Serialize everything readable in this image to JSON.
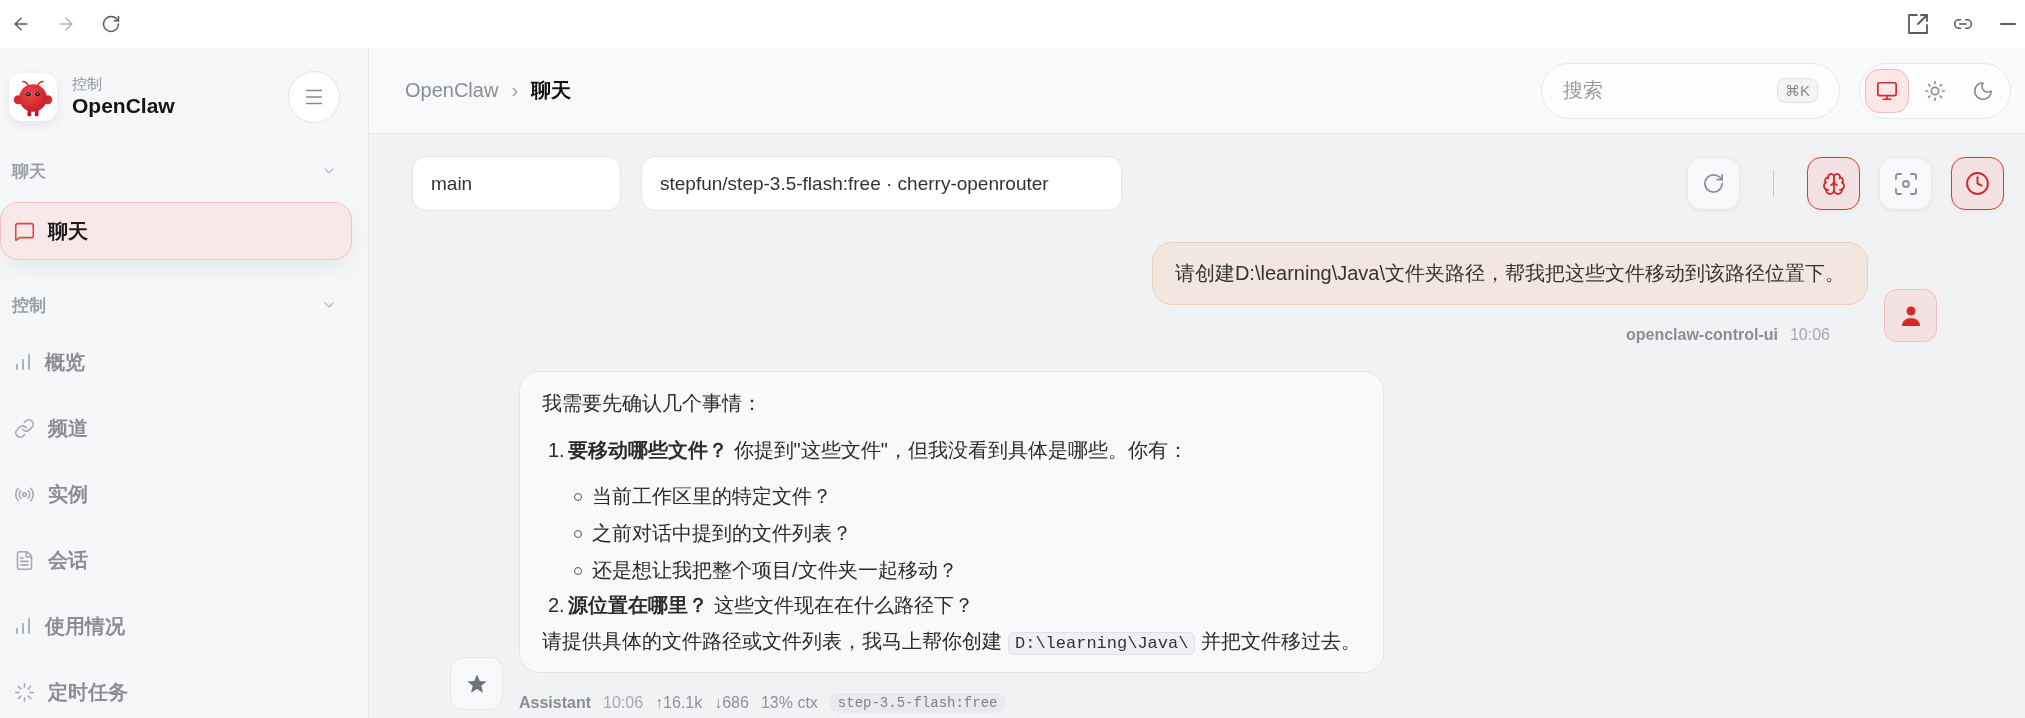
{
  "browser_bar": {
    "back_disabled": false,
    "forward_disabled": true
  },
  "sidebar": {
    "brand": {
      "subtitle": "控制",
      "name": "OpenClaw"
    },
    "sections": [
      {
        "title": "聊天",
        "expanded": true,
        "items": [
          {
            "label": "聊天",
            "kind": "chat",
            "selected": true
          }
        ]
      },
      {
        "title": "控制",
        "expanded": true,
        "items": [
          {
            "label": "概览",
            "kind": "bars",
            "selected": false
          },
          {
            "label": "频道",
            "kind": "link",
            "selected": false
          },
          {
            "label": "实例",
            "kind": "broadcast",
            "selected": false
          },
          {
            "label": "会话",
            "kind": "document",
            "selected": false
          },
          {
            "label": "使用情况",
            "kind": "bars",
            "selected": false
          },
          {
            "label": "定时任务",
            "kind": "loader",
            "selected": false
          }
        ]
      }
    ]
  },
  "header": {
    "breadcrumb": {
      "items": [
        "OpenClaw",
        "聊天"
      ],
      "separator": "›"
    },
    "search": {
      "placeholder": "搜索",
      "shortcut": "⌘K"
    },
    "theme_modes": [
      {
        "kind": "system",
        "selected": true
      },
      {
        "kind": "light",
        "selected": false
      },
      {
        "kind": "dark",
        "selected": false
      }
    ]
  },
  "chat_controls": {
    "session": "main",
    "model": "stepfun/step-3.5-flash:free · cherry-openrouter",
    "actions": [
      {
        "kind": "refresh",
        "on": false
      },
      {
        "kind": "thinking",
        "on": true
      },
      {
        "kind": "focus",
        "on": false
      },
      {
        "kind": "schedule",
        "on": true
      }
    ]
  },
  "messages": [
    {
      "kind": "user",
      "text": "请创建D:\\learning\\Java\\文件夹路径，帮我把这些文件移动到该路径位置下。",
      "sender": "openclaw-control-ui",
      "time": "10:06"
    },
    {
      "kind": "assistant",
      "blocks": [
        {
          "kind": "paragraph",
          "parts": [
            {
              "kind": "text",
              "text": "我需要先确认几个事情："
            }
          ]
        },
        {
          "kind": "ordered_list",
          "items": [
            {
              "number": "1.",
              "text": "**要移动哪些文件？** 你提到\"这些文件\"，但我没看到具体是哪些。你有：",
              "children": [
                "当前工作区里的特定文件？",
                "之前对话中提到的文件列表？",
                "还是想让我把整个项目/文件夹一起移动？"
              ]
            },
            {
              "number": "2.",
              "text": "**源位置在哪里？** 这些文件现在在什么路径下？"
            }
          ]
        },
        {
          "kind": "paragraph",
          "parts": [
            {
              "kind": "text",
              "text": "请提供具体的文件路径或文件列表，我马上帮你创建"
            },
            {
              "kind": "code",
              "text": "D:\\learning\\Java\\"
            },
            {
              "kind": "text",
              "text": "并把文件移过去。"
            }
          ]
        }
      ],
      "sender": "Assistant",
      "time": "10:06",
      "stats": [
        "↑16.1k",
        "↓686",
        "13% ctx"
      ],
      "model": "step-3.5-flash:free"
    }
  ]
}
